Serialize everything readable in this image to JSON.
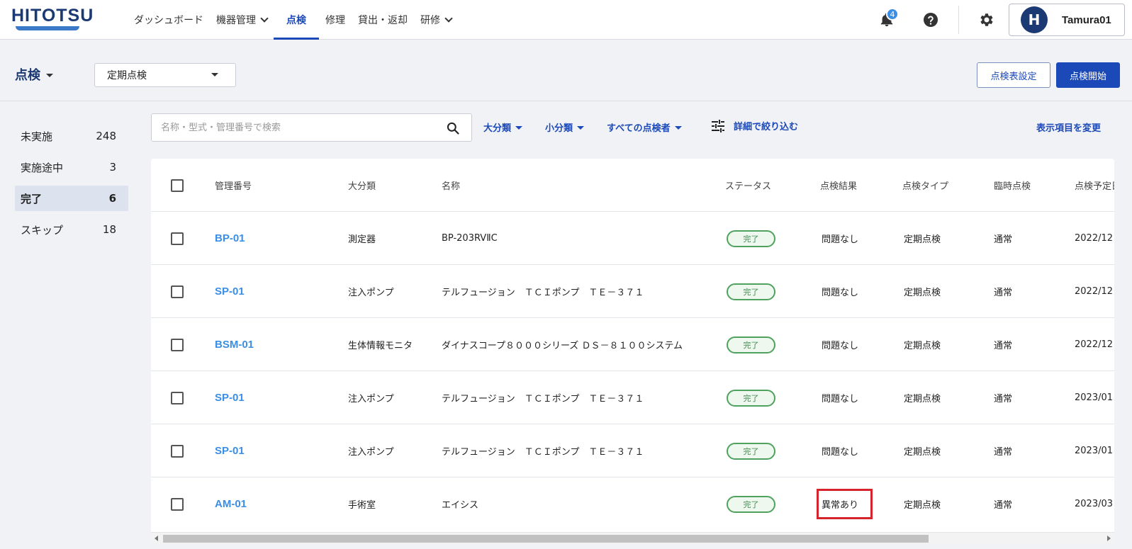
{
  "brand": {
    "logo_text": "HITOTSU",
    "accent": "#1b49b8",
    "logo_color": "#1b3a73"
  },
  "nav": {
    "items": [
      {
        "label": "ダッシュボード",
        "has_menu": false,
        "active": false
      },
      {
        "label": "機器管理",
        "has_menu": true,
        "active": false
      },
      {
        "label": "点検",
        "has_menu": false,
        "active": true
      },
      {
        "label": "修理",
        "has_menu": false,
        "active": false
      },
      {
        "label": "貸出・返却",
        "has_menu": false,
        "active": false
      },
      {
        "label": "研修",
        "has_menu": true,
        "active": false
      }
    ]
  },
  "header": {
    "notification_count": "4",
    "avatar_initial": "H",
    "username": "Tamura01",
    "icons": [
      "bell-icon",
      "help-icon",
      "gear-icon"
    ]
  },
  "subheader": {
    "title": "点検",
    "type_select_value": "定期点検",
    "settings_button": "点検表設定",
    "start_button": "点検開始"
  },
  "sidebar": {
    "items": [
      {
        "label": "未実施",
        "count": "248",
        "active": false
      },
      {
        "label": "実施途中",
        "count": "3",
        "active": false
      },
      {
        "label": "完了",
        "count": "6",
        "active": true
      },
      {
        "label": "スキップ",
        "count": "18",
        "active": false
      }
    ]
  },
  "filters": {
    "search_placeholder": "名称・型式・管理番号で検索",
    "category_major": "大分類",
    "category_minor": "小分類",
    "inspector": "すべての点検者",
    "advanced": "詳細で絞り込む",
    "change_columns": "表示項目を変更"
  },
  "table": {
    "headers": [
      "管理番号",
      "大分類",
      "名称",
      "ステータス",
      "点検結果",
      "点検タイプ",
      "臨時点検",
      "点検予定日"
    ],
    "rows": [
      {
        "code": "BP-01",
        "category": "測定器",
        "name": "BP-203RVⅡC",
        "status": "完了",
        "result": "問題なし",
        "type": "定期点検",
        "extra": "通常",
        "date": "2022/12"
      },
      {
        "code": "SP-01",
        "category": "注入ポンプ",
        "name": "テルフュージョン　ＴＣＩポンプ　ＴＥ－３７１",
        "status": "完了",
        "result": "問題なし",
        "type": "定期点検",
        "extra": "通常",
        "date": "2022/12"
      },
      {
        "code": "BSM-01",
        "category": "生体情報モニタ",
        "name": "ダイナスコープ８０００シリーズ ＤＳ－８１００システム",
        "status": "完了",
        "result": "問題なし",
        "type": "定期点検",
        "extra": "通常",
        "date": "2022/12"
      },
      {
        "code": "SP-01",
        "category": "注入ポンプ",
        "name": "テルフュージョン　ＴＣＩポンプ　ＴＥ－３７１",
        "status": "完了",
        "result": "問題なし",
        "type": "定期点検",
        "extra": "通常",
        "date": "2023/01"
      },
      {
        "code": "SP-01",
        "category": "注入ポンプ",
        "name": "テルフュージョン　ＴＣＩポンプ　ＴＥ－３７１",
        "status": "完了",
        "result": "問題なし",
        "type": "定期点検",
        "extra": "通常",
        "date": "2023/01"
      },
      {
        "code": "AM-01",
        "category": "手術室",
        "name": "エイシス",
        "status": "完了",
        "result": "異常あり",
        "type": "定期点検",
        "extra": "通常",
        "date": "2023/03",
        "highlight": true
      }
    ]
  },
  "colors": {
    "status_green": "#4ea25e",
    "link_blue": "#3a8ee6",
    "highlight_red": "#d7232c"
  }
}
